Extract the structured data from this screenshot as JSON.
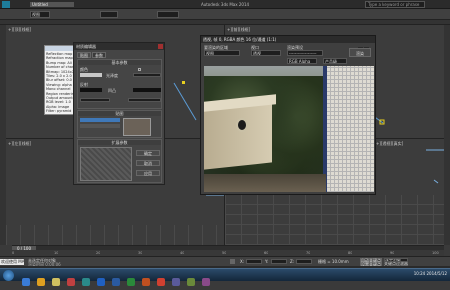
{
  "app": {
    "title": "Autodesk 3ds Max 2014",
    "file_tab": "Untitled",
    "search_placeholder": "Type a keyword or phrase"
  },
  "toolbar": {
    "view_dropdown": "视图"
  },
  "viewports": {
    "top_left_label": "+][顶][线框]",
    "front_label": "+][前][线框]",
    "left_label": "+][左][线框]",
    "persp_label": "+][透视][真实]"
  },
  "material_editor": {
    "title": "材质编辑器",
    "tab1": "贴图",
    "tab2": "参数",
    "section_basic": "基本参数",
    "section_maps": "贴图",
    "section_extended": "扩展参数",
    "label_color": "颜色",
    "label_gloss": "光泽度",
    "label_refl": "反射",
    "label_bump": "凹凸",
    "value_none": "无",
    "btn_ok": "确定",
    "btn_cancel": "取消",
    "btn_apply": "应用"
  },
  "help_panel": {
    "lines": [
      "Reflection map",
      "Refraction map",
      "Bump map: Ali",
      "Number of channels",
      "Bitmap: 1024x768",
      "Tiles: 2.0 x 2.0",
      "Blur offset: 0.0",
      "Viewing: alpha",
      "Mono channel",
      "Region rendering",
      "Output amount",
      "RGB level: 1.0",
      "Alpha: image",
      "Filter: pyramid"
    ]
  },
  "render_window": {
    "title": "透视, 帧 0, RGBA 颜色 16 位/通道 (1:1)",
    "area_label": "要渲染的区域",
    "area_value": "视图",
    "viewport_label": "视口",
    "viewport_value": "透视",
    "preset_label": "渲染预设",
    "preset_value": "-------------------",
    "render_button": "渲染",
    "channel_value": "RGB Alpha",
    "production_value": "产品级"
  },
  "timeline": {
    "frame_display": "0 / 100",
    "ticks": [
      "0",
      "10",
      "20",
      "30",
      "40",
      "50",
      "60",
      "70",
      "80",
      "90",
      "100"
    ]
  },
  "status": {
    "left_text": "未选定任何对象",
    "prompt_text": "渲染时间 0:00:06",
    "x_label": "X:",
    "y_label": "Y:",
    "z_label": "Z:",
    "grid_text": "栅格 = 10.0mm",
    "auto_key": "自动关键点",
    "set_key": "设置关键点",
    "selected": "选定对象",
    "key_filters": "关键点过滤器..."
  },
  "maxscript": {
    "label": "欢迎使用 MAXSc"
  },
  "taskbar": {
    "items": [
      "start",
      "ie",
      "folder",
      "media",
      "3dsmax",
      "ps",
      "word",
      "excel",
      "ppt",
      "chrome",
      "app1",
      "app2",
      "app3"
    ],
    "tray": "10:24 2014/5/12"
  },
  "colors": {
    "accent_blue": "#1e5fb0",
    "viewport_bg": "#3c3c3c",
    "panel_bg": "#454545",
    "taskbar_bg": "#1a3550"
  }
}
